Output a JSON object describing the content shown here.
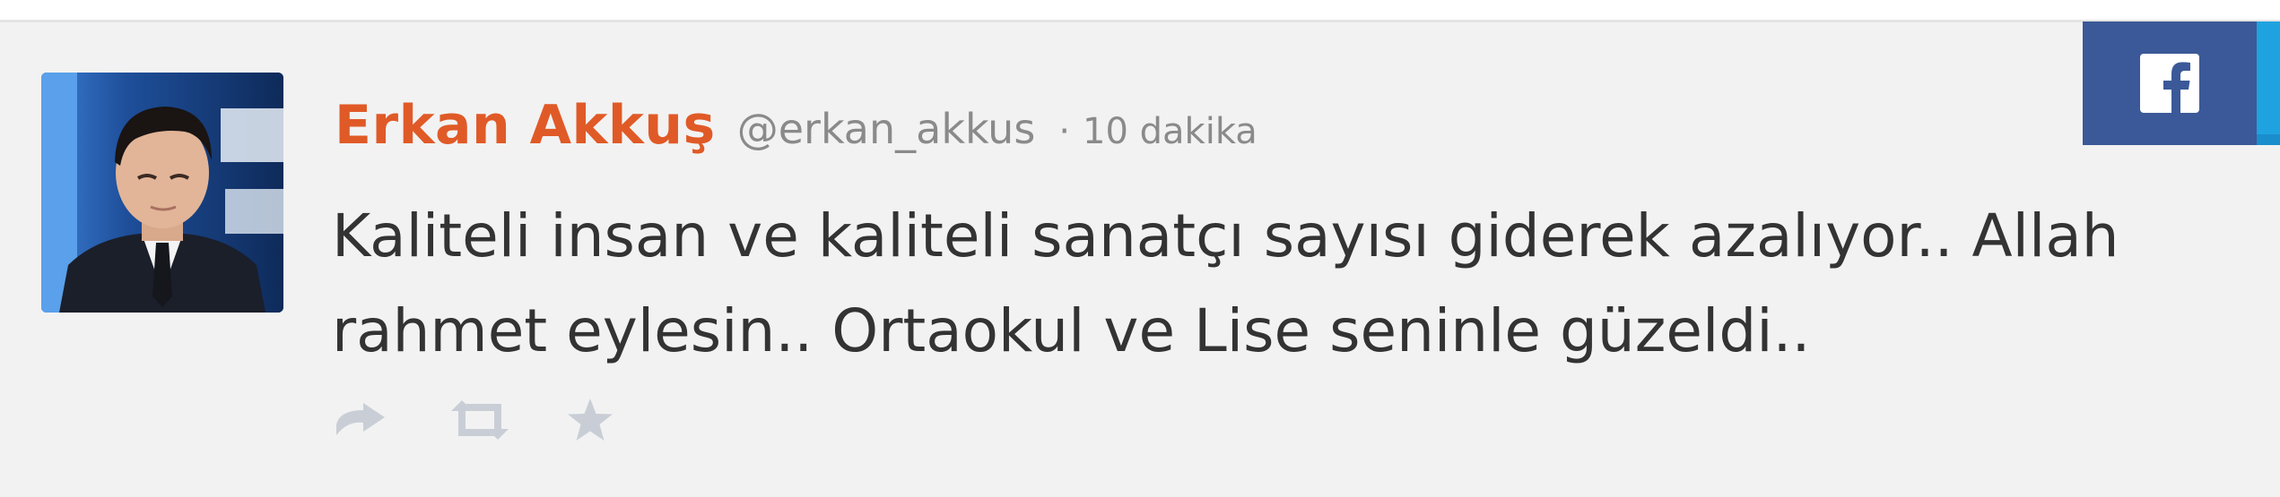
{
  "tweet": {
    "author_name": "Erkan Akkuş",
    "handle": "@erkan_akkus",
    "separator": "·",
    "timestamp": "10 dakika",
    "text_lines": [
      "Kaliteli insan ve kaliteli sanatçı sayısı giderek azalıyor.. Allah",
      "rahmet eylesin.. Ortaokul ve Lise seninle güzeldi.."
    ],
    "actions": [
      {
        "name": "reply",
        "icon": "reply-icon"
      },
      {
        "name": "retweet",
        "icon": "retweet-icon"
      },
      {
        "name": "favorite",
        "icon": "star-icon"
      }
    ]
  },
  "share": {
    "facebook_icon": "facebook-icon"
  },
  "colors": {
    "name": "#e05a27",
    "meta": "#8a8a8a",
    "text": "#333333",
    "card_bg": "#f2f2f2",
    "facebook": "#3b5998",
    "twitter_strip": "#1fa3e0",
    "action_icons": "#c9ced6"
  }
}
